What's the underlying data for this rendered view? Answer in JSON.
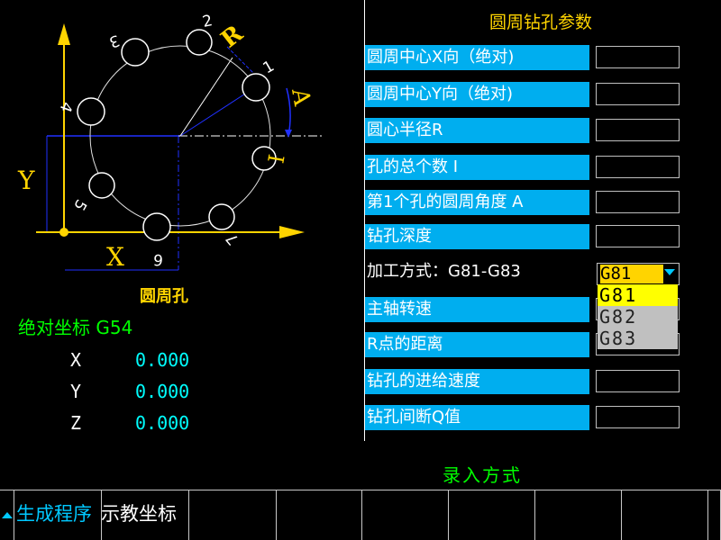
{
  "diagram": {
    "caption": "圆周孔",
    "axis_y": "Y",
    "axis_x": "X",
    "label_r": "R",
    "label_a": "A",
    "label_i": "I",
    "holes": [
      "1",
      "2",
      "3",
      "4",
      "5",
      "6",
      "7"
    ]
  },
  "panel": {
    "title": "圆周钻孔参数",
    "params": [
      {
        "label": "圆周中心X向（绝对)",
        "value": ""
      },
      {
        "label": "圆周中心Y向（绝对)",
        "value": ""
      },
      {
        "label": " 圆心半径R",
        "value": ""
      },
      {
        "label": "孔的总个数 I",
        "value": ""
      },
      {
        "label": "第1个孔的圆周角度 A",
        "value": ""
      },
      {
        "label": " 钻孔深度",
        "value": ""
      },
      {
        "label": "加工方式：G81-G83",
        "value": "G81"
      },
      {
        "label": "主轴转速",
        "value": ""
      },
      {
        "label": "R点的距离",
        "value": ""
      },
      {
        "label": "钻孔的进给速度",
        "value": ""
      },
      {
        "label": "钻孔间断Q值",
        "value": ""
      }
    ],
    "dropdown_options": [
      "G81",
      "G82",
      "G83"
    ]
  },
  "coords": {
    "title": "绝对坐标 G54",
    "axes": [
      {
        "name": "X",
        "value": "0.000"
      },
      {
        "name": "Y",
        "value": "0.000"
      },
      {
        "name": "Z",
        "value": "0.000"
      }
    ]
  },
  "status": {
    "mode": "录入方式"
  },
  "softkeys": [
    {
      "label": "生成程序",
      "color": "#00c8ff"
    },
    {
      "label": "示教坐标",
      "color": "#ffffff"
    },
    {
      "label": ""
    },
    {
      "label": ""
    },
    {
      "label": ""
    },
    {
      "label": ""
    },
    {
      "label": ""
    },
    {
      "label": ""
    }
  ]
}
